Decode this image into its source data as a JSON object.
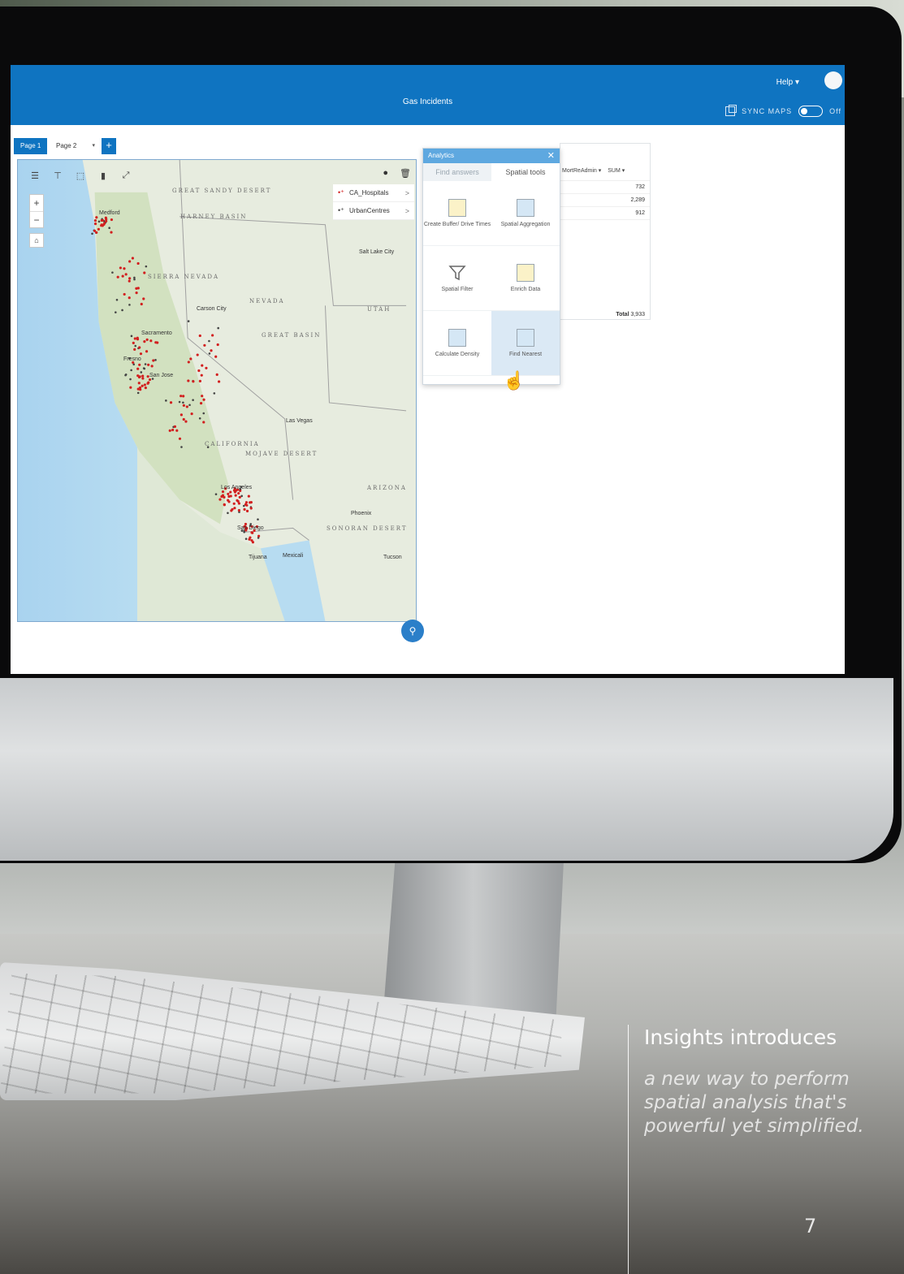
{
  "app": {
    "title": "Gas Incidents",
    "help_label": "Help ▾",
    "sync_maps_label": "SYNC MAPS",
    "sync_state_label": "Off"
  },
  "page_tabs": {
    "tab1": "Page 1",
    "tab2": "Page 2",
    "add": "+"
  },
  "map": {
    "toolbar_icons": [
      "list-icon",
      "filter-icon",
      "select-icon",
      "bar-chart-icon",
      "fullscreen-icon",
      "info-icon",
      "trash-icon"
    ],
    "layers": [
      {
        "label": "CA_Hospitals",
        "color": "#d21f1f"
      },
      {
        "label": "UrbanCentres",
        "color": "#444444"
      }
    ],
    "region_labels": [
      "GREAT SANDY DESERT",
      "HARNEY BASIN",
      "GREAT BASIN",
      "MOJAVE DESERT",
      "SONORAN DESERT",
      "NEVADA",
      "UTAH",
      "ARIZONA",
      "CALIFORNIA",
      "SIERRA NEVADA"
    ],
    "city_labels": [
      "Medford",
      "Sacramento",
      "Fresno",
      "San Jose",
      "Carson City",
      "Las Vegas",
      "Los Angeles",
      "San Diego",
      "Tijuana",
      "Mexicali",
      "Phoenix",
      "Tucson",
      "Salt Lake City"
    ]
  },
  "analytics": {
    "title": "Analytics",
    "tab_find_answers": "Find answers",
    "tab_spatial_tools": "Spatial tools",
    "tools": [
      {
        "label": "Create Buffer/ Drive Times",
        "icon": "buffer-icon"
      },
      {
        "label": "Spatial Aggregation",
        "icon": "aggregation-icon"
      },
      {
        "label": "Spatial Filter",
        "icon": "funnel-icon"
      },
      {
        "label": "Enrich Data",
        "icon": "enrich-icon"
      },
      {
        "label": "Calculate Density",
        "icon": "density-icon"
      },
      {
        "label": "Find Nearest",
        "icon": "nearest-icon"
      }
    ]
  },
  "table": {
    "col1": "MortReAdmin ▾",
    "col2": "SUM ▾",
    "rows": [
      "732",
      "2,289",
      "912"
    ],
    "total_label": "Total",
    "total_value": "3,933"
  },
  "caption": {
    "title": "Insights introduces",
    "body": "a new way to perform spatial analysis that's powerful yet simplified.",
    "page_number": "7"
  },
  "colors": {
    "header_blue": "#0f74c1",
    "hospital_red": "#d21f1f"
  }
}
